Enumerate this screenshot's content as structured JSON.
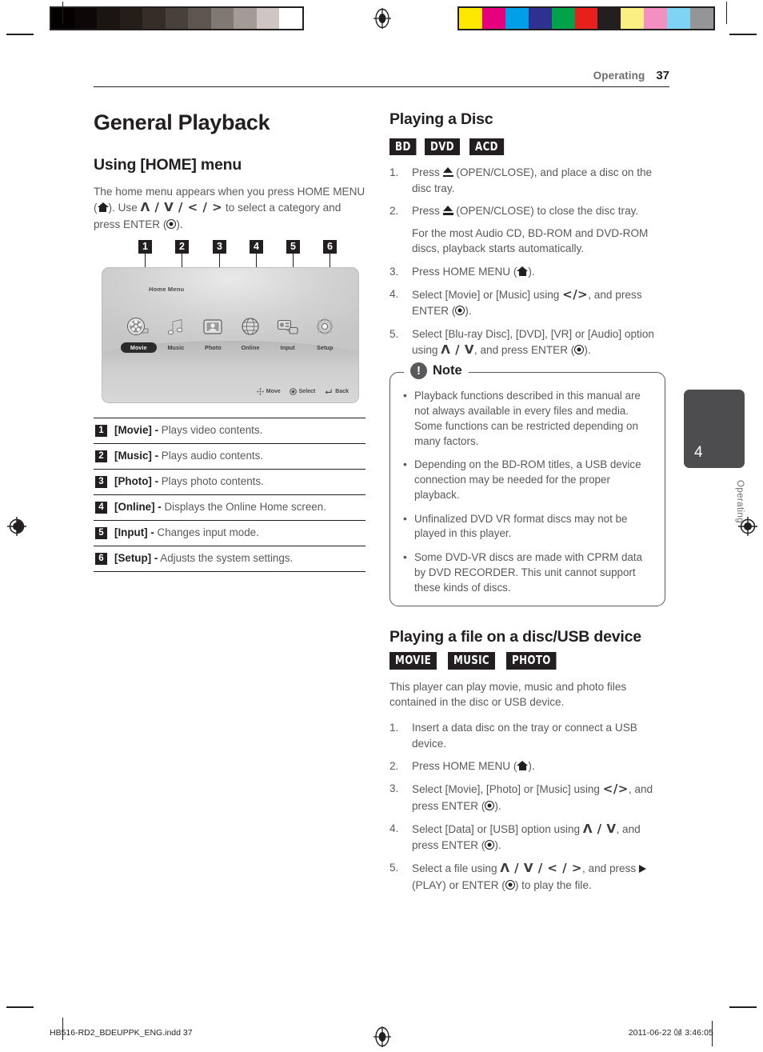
{
  "print_marks": {
    "gray_bar_name": "grayscale-calibration-bar",
    "gray_steps": [
      "#050000",
      "#0d0707",
      "#1b1512",
      "#241d19",
      "#362d29",
      "#47403c",
      "#5e5551",
      "#807873",
      "#a49b97",
      "#cfc6c3",
      "#ffffff"
    ],
    "color_bar_name": "color-calibration-bar",
    "color_steps": [
      "#ffe800",
      "#e6007e",
      "#00a0e9",
      "#2e3192",
      "#00a24a",
      "#e8201c",
      "#231f20",
      "#fbef84",
      "#f48fc1",
      "#7fd4f4",
      "#939598"
    ]
  },
  "header": {
    "section": "Operating",
    "page_number": "37"
  },
  "left_column": {
    "title": "General Playback",
    "subtitle": "Using [HOME] menu",
    "intro": {
      "part1": "The home menu appears when you press HOME MENU (",
      "part2": "). Use ",
      "nav_keys": "Λ / V / < / >",
      "part3": " to select a category and press ENTER (",
      "part4": ")."
    },
    "figure": {
      "screen_title": "Home Menu",
      "callout_numbers": [
        "1",
        "2",
        "3",
        "4",
        "5",
        "6"
      ],
      "menu_items": [
        {
          "label": "Movie",
          "icon": "film-reel-icon",
          "selected": true
        },
        {
          "label": "Music",
          "icon": "music-note-icon",
          "selected": false
        },
        {
          "label": "Photo",
          "icon": "photo-frame-icon",
          "selected": false
        },
        {
          "label": "Online",
          "icon": "globe-icon",
          "selected": false
        },
        {
          "label": "Input",
          "icon": "input-device-icon",
          "selected": false
        },
        {
          "label": "Setup",
          "icon": "gear-icon",
          "selected": false
        }
      ],
      "hints": [
        {
          "icon": "dpad-icon",
          "label": "Move"
        },
        {
          "icon": "enter-icon",
          "label": "Select"
        },
        {
          "icon": "return-arrow-icon",
          "label": "Back"
        }
      ]
    },
    "legend": [
      {
        "num": "1",
        "term": "[Movie] -",
        "desc": " Plays video contents."
      },
      {
        "num": "2",
        "term": "[Music] -",
        "desc": " Plays audio contents."
      },
      {
        "num": "3",
        "term": "[Photo] -",
        "desc": " Plays photo contents."
      },
      {
        "num": "4",
        "term": "[Online] -",
        "desc": " Displays the Online Home screen."
      },
      {
        "num": "5",
        "term": "[Input] -",
        "desc": " Changes input mode."
      },
      {
        "num": "6",
        "term": "[Setup] -",
        "desc": " Adjusts the system settings."
      }
    ]
  },
  "right_column": {
    "disc_section": {
      "title": "Playing a Disc",
      "badges": [
        "BD",
        "DVD",
        "ACD"
      ],
      "steps": [
        {
          "num": "1.",
          "pre": "Press ",
          "icon": "eject-icon",
          "post": " (OPEN/CLOSE), and place a disc on the disc tray."
        },
        {
          "num": "2.",
          "pre": "Press ",
          "icon": "eject-icon",
          "post": " (OPEN/CLOSE) to close the disc tray."
        },
        {
          "num": "3.",
          "pre": "Press HOME MENU (",
          "icon": "home-icon",
          "post": ")."
        },
        {
          "num": "4.",
          "pre": "Select [Movie] or [Music] using ",
          "nav": "</>",
          "post": ", and press ENTER (",
          "post2": ")."
        },
        {
          "num": "5.",
          "pre": "Select [Blu-ray Disc], [DVD], [VR] or [Audio] option using ",
          "nav": "Λ / V",
          "post": ", and press ENTER (",
          "post2": ")."
        }
      ],
      "substep_2": "For the most Audio CD, BD-ROM and DVD-ROM discs, playback starts automatically."
    },
    "note": {
      "title": "Note",
      "icon": "exclamation-icon",
      "icon_glyph": "!",
      "items": [
        "Playback functions described in this manual are not always available in every files and media. Some functions can be restricted depending on many factors.",
        "Depending on the BD-ROM titles, a USB device connection may be needed for the proper playback.",
        "Unfinalized DVD VR format discs may not be played in this player.",
        "Some DVD-VR discs are made with CPRM data by DVD RECORDER. This unit cannot support these kinds of discs."
      ]
    },
    "file_section": {
      "title": "Playing a file on a disc/USB device",
      "badges": [
        "MOVIE",
        "MUSIC",
        "PHOTO"
      ],
      "intro": "This player can play movie, music and photo files contained in the disc or USB device.",
      "steps": [
        {
          "num": "1.",
          "pre": "Insert a data disc on the tray or connect a USB device."
        },
        {
          "num": "2.",
          "pre": "Press HOME MENU (",
          "icon": "home-icon",
          "post": ")."
        },
        {
          "num": "3.",
          "pre": "Select [Movie], [Photo] or [Music] using ",
          "nav": "</>",
          "post": ", and press ENTER (",
          "post2": ")."
        },
        {
          "num": "4.",
          "pre": "Select [Data] or [USB] option using ",
          "nav": "Λ / V",
          "post": ", and press ENTER (",
          "post2": ")."
        },
        {
          "num": "5.",
          "pre": "Select a file using ",
          "nav": "Λ / V / < / >",
          "post": ", and press ",
          "post2": "(PLAY) or ENTER (",
          "post3": ") to play the file."
        }
      ]
    }
  },
  "side_tab": {
    "number": "4",
    "label": "Operating",
    "color": "#4d4d4f"
  },
  "footer": {
    "left": "HB516-RD2_BDEUPPK_ENG.indd   37",
    "right": "2011-06-22   ㍘ 3:46:05"
  }
}
